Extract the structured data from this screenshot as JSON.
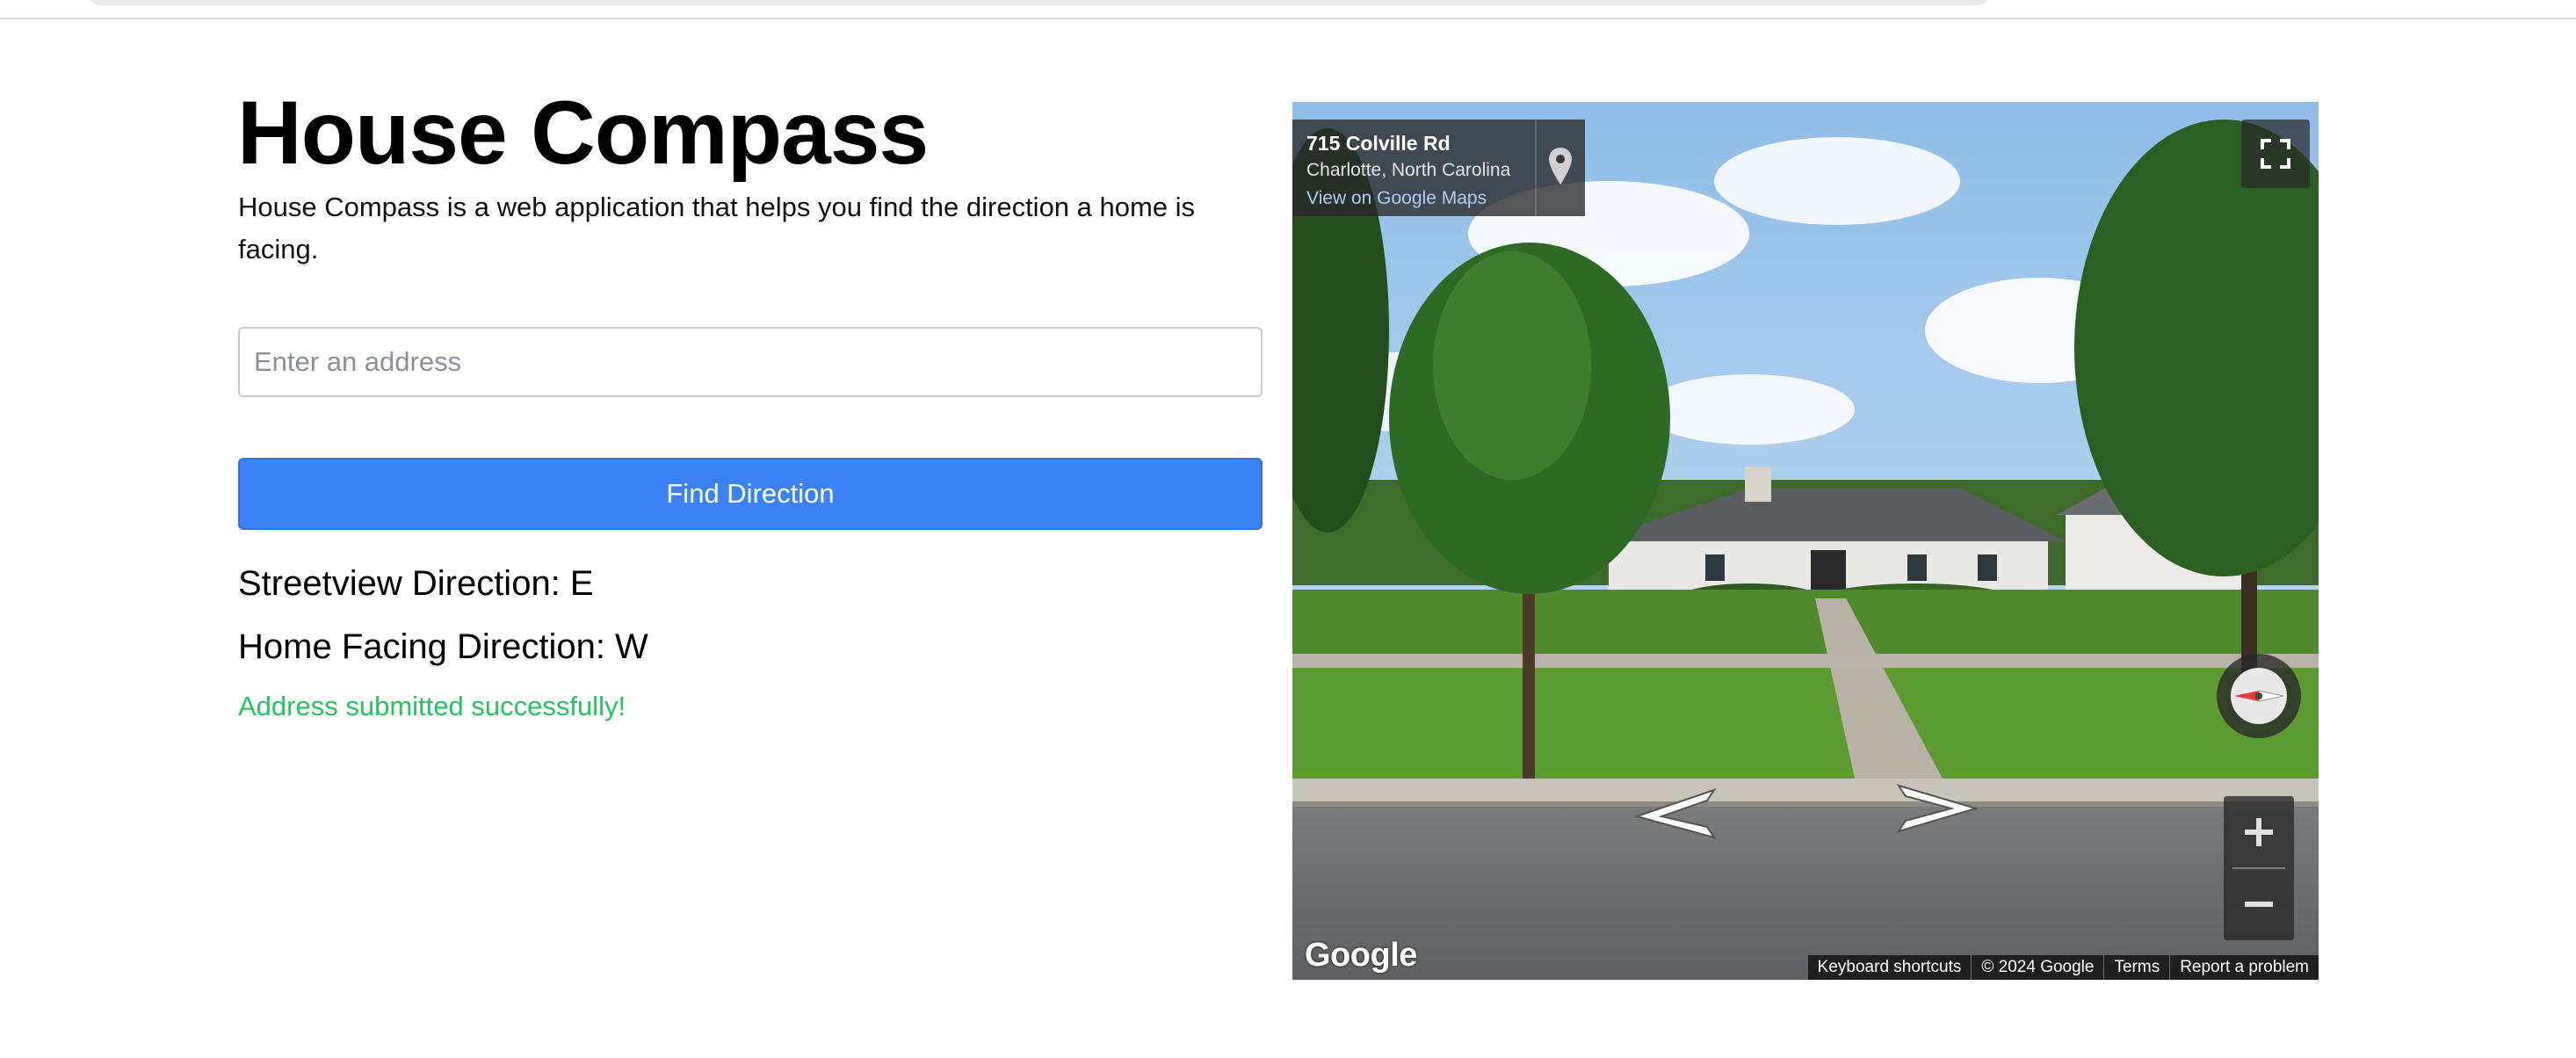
{
  "page": {
    "title": "House Compass",
    "description": "House Compass is a web application that helps you find the direction a home is facing."
  },
  "form": {
    "address_placeholder": "Enter an address",
    "address_value": "",
    "submit_label": "Find Direction"
  },
  "results": {
    "streetview_direction": "Streetview Direction: E",
    "home_facing_direction": "Home Facing Direction: W",
    "status_message": "Address submitted successfully!"
  },
  "streetview": {
    "address_line1": "715 Colville Rd",
    "address_line2": "Charlotte, North Carolina",
    "maps_link": "View on Google Maps",
    "logo_text": "Google",
    "footer": [
      "Keyboard shortcuts",
      "© 2024 Google",
      "Terms",
      "Report a problem"
    ]
  },
  "colors": {
    "primary_button": "#3b82f6",
    "success_text": "#22c55e"
  }
}
